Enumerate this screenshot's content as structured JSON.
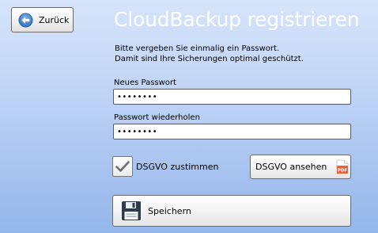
{
  "header": {
    "back_label": "Zurück",
    "title": "CloudBackup registrieren"
  },
  "description": {
    "line1": "Bitte vergeben Sie einmalig ein Passwort.",
    "line2": "Damit sind Ihre Sicherungen optimal geschützt."
  },
  "form": {
    "new_password_label": "Neues Passwort",
    "new_password_value": "••••••••",
    "repeat_password_label": "Passwort wiederholen",
    "repeat_password_value": "••••••••"
  },
  "consent": {
    "checkbox_label": "DSGVO zustimmen",
    "checked": true,
    "view_button_label": "DSGVO ansehen",
    "view_button_icon": "pdf-icon"
  },
  "actions": {
    "save_label": "Speichern",
    "save_icon": "floppy-disk-icon"
  },
  "colors": {
    "accent_back": "#2f6fbf",
    "pdf": "#e8643a"
  }
}
